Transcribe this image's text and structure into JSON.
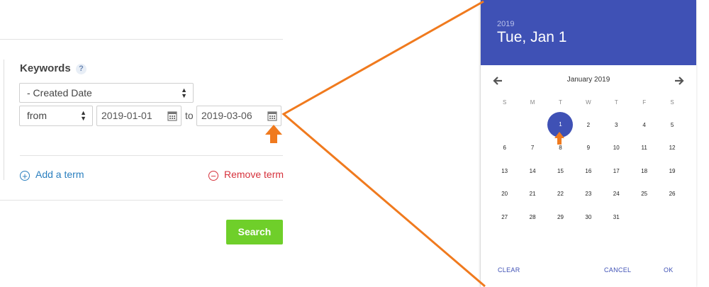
{
  "form": {
    "keywords_label": "Keywords",
    "help_text": "?",
    "field_select": "- Created Date",
    "range_select": "from",
    "date_from": "2019-01-01",
    "date_to": "2019-03-06",
    "to_label": "to",
    "add_term": "Add a term",
    "remove_term": "Remove term",
    "search_button": "Search"
  },
  "picker": {
    "year": "2019",
    "selected_date": "Tue, Jan 1",
    "month_title": "January 2019",
    "weekdays": [
      "S",
      "M",
      "T",
      "W",
      "T",
      "F",
      "S"
    ],
    "weeks": [
      [
        "",
        "",
        "1",
        "2",
        "3",
        "4",
        "5"
      ],
      [
        "6",
        "7",
        "8",
        "9",
        "10",
        "11",
        "12"
      ],
      [
        "13",
        "14",
        "15",
        "16",
        "17",
        "18",
        "19"
      ],
      [
        "20",
        "21",
        "22",
        "23",
        "24",
        "25",
        "26"
      ],
      [
        "27",
        "28",
        "29",
        "30",
        "31",
        "",
        ""
      ]
    ],
    "selected_day": "1",
    "clear_label": "CLEAR",
    "cancel_label": "CANCEL",
    "ok_label": "OK"
  },
  "colors": {
    "accent": "#3f51b5",
    "annotation": "#f07a1e",
    "search_green": "#6fcf2a",
    "add_blue": "#2a7fbf",
    "remove_red": "#d6323c"
  },
  "icons": [
    "help-icon",
    "sort-arrows-icon",
    "calendar-icon",
    "plus-circle-icon",
    "minus-circle-icon",
    "arrow-left-icon",
    "arrow-right-icon",
    "annotation-arrow-icon"
  ]
}
